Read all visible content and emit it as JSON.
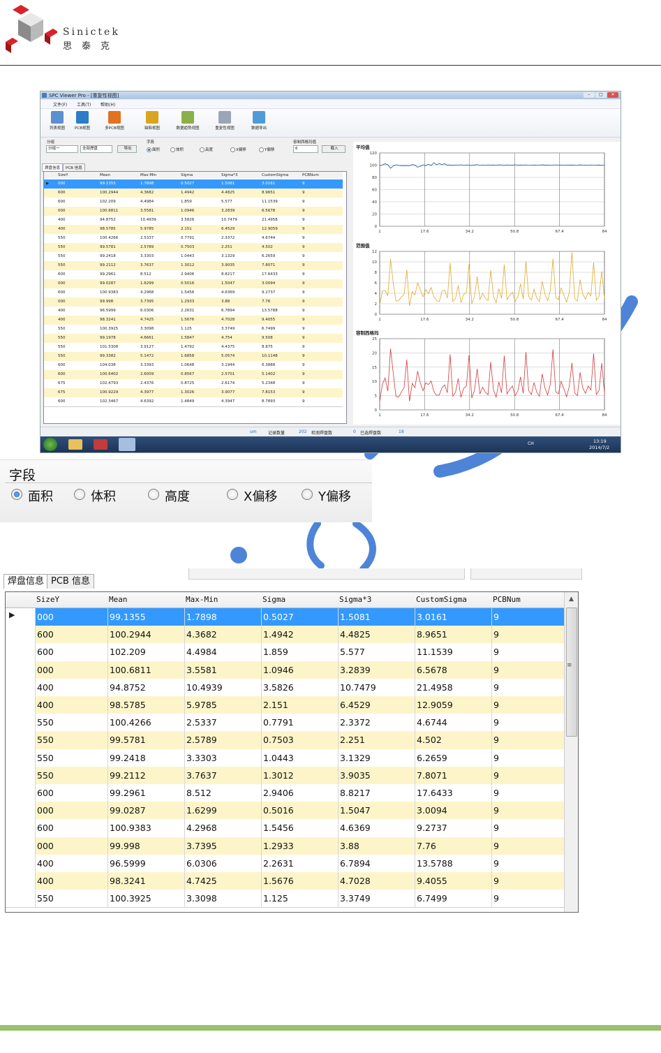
{
  "header": {
    "brand_en": "Sinictek",
    "brand_cn": "思泰克"
  },
  "app": {
    "title": "SPC Viewer Pro - [重复性视图]",
    "menu": [
      "文件(F)",
      "工具(T)",
      "帮助(H)"
    ],
    "toolbar": [
      "列表视图",
      "PCB视图",
      "多PCB视图",
      "缺陷视图",
      "数据趋势视图",
      "重复性视图",
      "数据导出"
    ],
    "controls": {
      "group_label": "分组",
      "group_value": "分组一",
      "pad_value": "全部焊盘",
      "export_label": "导出",
      "field_label": "字段",
      "fields": [
        "面积",
        "体积",
        "高度",
        "X偏移",
        "Y偏移"
      ],
      "tolerance_label": "容制西格玛值",
      "tolerance_value": "6",
      "load_label": "载入"
    },
    "tabs": [
      "焊盘信息",
      "PCB 信息"
    ],
    "columns": [
      "SizeY",
      "Mean",
      "Max-Min",
      "Sigma",
      "Sigma*3",
      "CustomSigma",
      "PCBNum"
    ],
    "rows": [
      [
        "000",
        "99.1355",
        "1.7898",
        "0.5027",
        "1.5081",
        "3.0161",
        "9"
      ],
      [
        "600",
        "100.2944",
        "4.3682",
        "1.4942",
        "4.4825",
        "8.9651",
        "9"
      ],
      [
        "600",
        "102.209",
        "4.4984",
        "1.859",
        "5.577",
        "11.1539",
        "9"
      ],
      [
        "000",
        "100.6811",
        "3.5581",
        "1.0946",
        "3.2839",
        "6.5678",
        "9"
      ],
      [
        "400",
        "94.8752",
        "10.4939",
        "3.5826",
        "10.7479",
        "21.4958",
        "9"
      ],
      [
        "400",
        "98.5785",
        "5.9785",
        "2.151",
        "6.4529",
        "12.9059",
        "9"
      ],
      [
        "550",
        "100.4266",
        "2.5337",
        "0.7791",
        "2.3372",
        "4.6744",
        "9"
      ],
      [
        "550",
        "99.5781",
        "2.5789",
        "0.7503",
        "2.251",
        "4.502",
        "9"
      ],
      [
        "550",
        "99.2418",
        "3.3303",
        "1.0443",
        "3.1329",
        "6.2659",
        "9"
      ],
      [
        "550",
        "99.2112",
        "3.7637",
        "1.3012",
        "3.9035",
        "7.8071",
        "9"
      ],
      [
        "600",
        "99.2961",
        "8.512",
        "2.9406",
        "8.8217",
        "17.6433",
        "9"
      ],
      [
        "000",
        "99.0287",
        "1.6299",
        "0.5016",
        "1.5047",
        "3.0094",
        "9"
      ],
      [
        "600",
        "100.9383",
        "4.2968",
        "1.5456",
        "4.6369",
        "9.2737",
        "9"
      ],
      [
        "000",
        "99.998",
        "3.7395",
        "1.2933",
        "3.88",
        "7.76",
        "9"
      ],
      [
        "400",
        "96.5999",
        "6.0306",
        "2.2631",
        "6.7894",
        "13.5788",
        "9"
      ],
      [
        "400",
        "98.3241",
        "4.7425",
        "1.5676",
        "4.7028",
        "9.4055",
        "9"
      ],
      [
        "550",
        "100.3925",
        "3.3098",
        "1.125",
        "3.3749",
        "6.7499",
        "9"
      ],
      [
        "550",
        "99.1978",
        "4.6661",
        "1.5847",
        "4.754",
        "9.508",
        "9"
      ],
      [
        "550",
        "101.5308",
        "3.9127",
        "1.4792",
        "4.4375",
        "8.875",
        "9"
      ],
      [
        "550",
        "99.3382",
        "5.1472",
        "1.6858",
        "5.0574",
        "10.1148",
        "9"
      ],
      [
        "600",
        "104.038",
        "3.3393",
        "1.0648",
        "3.1944",
        "6.3888",
        "9"
      ],
      [
        "600",
        "100.6402",
        "2.6009",
        "0.8567",
        "2.5701",
        "5.1402",
        "9"
      ],
      [
        "675",
        "102.4793",
        "2.4376",
        "0.8725",
        "2.6174",
        "5.2348",
        "9"
      ],
      [
        "675",
        "100.9229",
        "4.3977",
        "1.3026",
        "3.9077",
        "7.8153",
        "9"
      ],
      [
        "600",
        "102.3467",
        "4.6392",
        "1.4849",
        "4.3947",
        "8.7893",
        "9"
      ]
    ],
    "status": {
      "unit": "um",
      "count_label": "记录数量",
      "count_value": "202",
      "pads_label": "检测焊盘数",
      "pads_value": "0",
      "selected_label": "已选焊盘数",
      "selected_value": "18"
    },
    "clock": {
      "time": "13:19",
      "date": "2014/7/2",
      "lang": "CH"
    }
  },
  "chart_data": [
    {
      "type": "line",
      "title": "平均值",
      "x_ticks": [
        "1",
        "17.6",
        "34.2",
        "50.8",
        "67.4",
        "84"
      ],
      "y_ticks": [
        "0",
        "20",
        "40",
        "60",
        "80",
        "100",
        "120"
      ],
      "ylim": [
        0,
        120
      ],
      "xlim": [
        1,
        84
      ],
      "color": "#1f4e8c",
      "values": [
        99.1,
        100.3,
        102.2,
        100.7,
        94.9,
        98.6,
        100.4,
        99.6,
        99.2,
        99.2,
        99.3,
        99.0,
        100.9,
        100.0,
        96.6,
        98.3,
        100.4,
        99.2,
        101.5,
        99.3,
        104.0,
        100.6,
        102.5,
        100.9,
        102.3,
        99.8,
        100.2,
        99.5,
        100.1,
        99.9,
        100.6,
        99.7,
        100.3,
        100.0,
        99.4,
        100.2,
        100.8,
        99.6,
        100.1,
        99.9,
        100.4,
        99.8,
        100.2,
        99.7,
        100.5,
        100.0,
        99.5,
        100.3,
        100.1,
        99.8,
        100.6,
        99.9,
        100.2,
        99.6,
        100.4,
        100.0,
        99.7,
        100.3,
        100.1,
        99.9,
        100.5,
        99.8,
        100.2,
        99.6,
        100.0,
        100.4,
        99.7,
        100.1,
        99.9,
        100.3,
        99.8,
        100.2,
        100.0,
        99.6,
        100.5,
        99.9,
        100.1,
        99.7,
        100.3,
        100.0,
        99.8,
        100.2,
        99.9,
        100.1
      ]
    },
    {
      "type": "line",
      "title": "范围值",
      "x_ticks": [
        "1",
        "17.6",
        "34.2",
        "50.8",
        "67.4",
        "84"
      ],
      "y_ticks": [
        "0",
        "2",
        "4",
        "6",
        "8",
        "10",
        "12"
      ],
      "ylim": [
        0,
        12
      ],
      "xlim": [
        1,
        84
      ],
      "color": "#e0a92a",
      "values": [
        1.8,
        4.4,
        4.5,
        3.6,
        10.5,
        6.0,
        2.5,
        2.6,
        3.3,
        3.8,
        8.5,
        1.6,
        4.3,
        3.7,
        6.0,
        4.7,
        3.3,
        4.7,
        3.9,
        5.1,
        3.3,
        2.6,
        2.4,
        4.4,
        4.6,
        3.1,
        9.8,
        2.4,
        3.0,
        5.5,
        2.2,
        3.8,
        4.1,
        9.6,
        2.0,
        3.4,
        7.2,
        2.8,
        4.0,
        3.1,
        2.6,
        8.4,
        3.5,
        2.2,
        4.9,
        3.0,
        9.5,
        2.8,
        3.6,
        4.2,
        2.5,
        3.3,
        5.8,
        2.9,
        10.1,
        3.4,
        2.7,
        4.8,
        3.1,
        2.4,
        6.3,
        3.9,
        2.6,
        4.5,
        10.6,
        3.2,
        2.8,
        5.0,
        3.7,
        2.3,
        4.1,
        11.8,
        3.0,
        2.5,
        6.6,
        3.8,
        2.9,
        4.2,
        3.5,
        9.9,
        2.7,
        3.4,
        8.2,
        3.0
      ]
    },
    {
      "type": "line",
      "title": "容制西格玛",
      "x_ticks": [
        "1",
        "17.6",
        "34.2",
        "50.8",
        "67.4",
        "84"
      ],
      "y_ticks": [
        "0",
        "5",
        "10",
        "15",
        "20",
        "25"
      ],
      "ylim": [
        0,
        25
      ],
      "xlim": [
        1,
        84
      ],
      "color": "#d33a3a",
      "values": [
        3.0,
        9.0,
        11.2,
        6.6,
        21.5,
        12.9,
        4.7,
        4.5,
        6.3,
        7.8,
        17.6,
        3.0,
        9.3,
        7.8,
        13.6,
        9.4,
        6.7,
        9.5,
        8.9,
        10.1,
        6.4,
        5.1,
        5.2,
        7.8,
        8.8,
        6.0,
        19.5,
        4.8,
        6.2,
        11.0,
        4.4,
        7.6,
        8.3,
        19.2,
        4.1,
        6.9,
        14.4,
        5.6,
        8.0,
        6.2,
        5.3,
        16.8,
        7.0,
        4.5,
        9.8,
        6.0,
        19.0,
        5.6,
        7.2,
        8.4,
        5.0,
        6.6,
        11.6,
        5.8,
        20.3,
        6.8,
        5.4,
        9.6,
        6.2,
        4.8,
        12.6,
        7.8,
        5.2,
        9.0,
        21.3,
        6.4,
        5.6,
        10.0,
        7.4,
        4.6,
        8.2,
        16.5,
        6.0,
        5.0,
        13.2,
        7.6,
        5.8,
        8.4,
        7.0,
        19.8,
        5.4,
        6.8,
        16.4,
        6.0
      ]
    }
  ],
  "zoom_field": {
    "title": "字段",
    "options": [
      "面积",
      "体积",
      "高度",
      "X偏移",
      "Y偏移"
    ],
    "selected_index": 0
  },
  "zoom_grid": {
    "tabs": [
      "焊盘信息",
      "PCB 信息"
    ],
    "columns": [
      "SizeY",
      "Mean",
      "Max-Min",
      "Sigma",
      "Sigma*3",
      "CustomSigma",
      "PCBNum"
    ],
    "rows": [
      [
        "000",
        "99.1355",
        "1.7898",
        "0.5027",
        "1.5081",
        "3.0161",
        "9"
      ],
      [
        "600",
        "100.2944",
        "4.3682",
        "1.4942",
        "4.4825",
        "8.9651",
        "9"
      ],
      [
        "600",
        "102.209",
        "4.4984",
        "1.859",
        "5.577",
        "11.1539",
        "9"
      ],
      [
        "000",
        "100.6811",
        "3.5581",
        "1.0946",
        "3.2839",
        "6.5678",
        "9"
      ],
      [
        "400",
        "94.8752",
        "10.4939",
        "3.5826",
        "10.7479",
        "21.4958",
        "9"
      ],
      [
        "400",
        "98.5785",
        "5.9785",
        "2.151",
        "6.4529",
        "12.9059",
        "9"
      ],
      [
        "550",
        "100.4266",
        "2.5337",
        "0.7791",
        "2.3372",
        "4.6744",
        "9"
      ],
      [
        "550",
        "99.5781",
        "2.5789",
        "0.7503",
        "2.251",
        "4.502",
        "9"
      ],
      [
        "550",
        "99.2418",
        "3.3303",
        "1.0443",
        "3.1329",
        "6.2659",
        "9"
      ],
      [
        "550",
        "99.2112",
        "3.7637",
        "1.3012",
        "3.9035",
        "7.8071",
        "9"
      ],
      [
        "600",
        "99.2961",
        "8.512",
        "2.9406",
        "8.8217",
        "17.6433",
        "9"
      ],
      [
        "000",
        "99.0287",
        "1.6299",
        "0.5016",
        "1.5047",
        "3.0094",
        "9"
      ],
      [
        "600",
        "100.9383",
        "4.2968",
        "1.5456",
        "4.6369",
        "9.2737",
        "9"
      ],
      [
        "000",
        "99.998",
        "3.7395",
        "1.2933",
        "3.88",
        "7.76",
        "9"
      ],
      [
        "400",
        "96.5999",
        "6.0306",
        "2.2631",
        "6.7894",
        "13.5788",
        "9"
      ],
      [
        "400",
        "98.3241",
        "4.7425",
        "1.5676",
        "4.7028",
        "9.4055",
        "9"
      ],
      [
        "550",
        "100.3925",
        "3.3098",
        "1.125",
        "3.3749",
        "6.7499",
        "9"
      ]
    ]
  },
  "colors": {
    "selected_row": "#3399ff",
    "alt_row": "#fdf5c9",
    "accent_green": "#98c16a",
    "watermark": "#2e6fd1"
  }
}
